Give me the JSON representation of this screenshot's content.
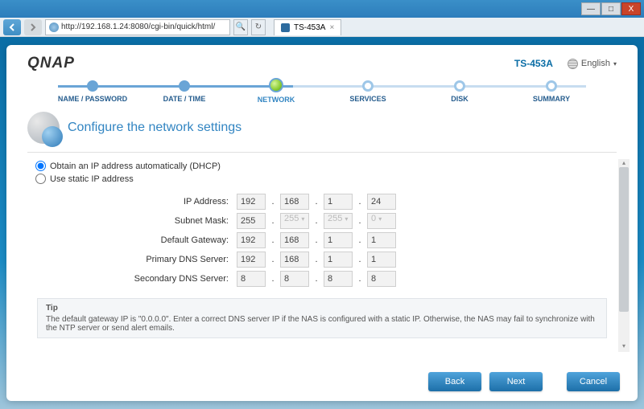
{
  "titlebar": {
    "min": "—",
    "max": "□",
    "close": "X"
  },
  "browser": {
    "url": "http://192.168.1.24:8080/cgi-bin/quick/html/",
    "tab_title": "TS-453A",
    "tab_close": "×",
    "refresh": "↻",
    "search": "🔍"
  },
  "header": {
    "logo": "QNAP",
    "model": "TS-453A",
    "language_label": "English",
    "language_arrow": "▾"
  },
  "steps": [
    {
      "label": "NAME / PASSWORD",
      "state": "done"
    },
    {
      "label": "DATE / TIME",
      "state": "done"
    },
    {
      "label": "NETWORK",
      "state": "current"
    },
    {
      "label": "SERVICES",
      "state": "future"
    },
    {
      "label": "DISK",
      "state": "future"
    },
    {
      "label": "SUMMARY",
      "state": "future"
    }
  ],
  "page": {
    "title": "Configure the network settings",
    "radio_dhcp": "Obtain an IP address automatically (DHCP)",
    "radio_static": "Use static IP address",
    "labels": {
      "ip": "IP Address:",
      "mask": "Subnet Mask:",
      "gw": "Default Gateway:",
      "dns1": "Primary DNS Server:",
      "dns2": "Secondary DNS Server:"
    },
    "values": {
      "ip": [
        "192",
        "168",
        "1",
        "24"
      ],
      "mask": [
        "255",
        "255",
        "255",
        "0"
      ],
      "gw": [
        "192",
        "168",
        "1",
        "1"
      ],
      "dns1": [
        "192",
        "168",
        "1",
        "1"
      ],
      "dns2": [
        "8",
        "8",
        "8",
        "8"
      ]
    },
    "tip_title": "Tip",
    "tip_body": "The default gateway IP is \"0.0.0.0\". Enter a correct DNS server IP if the NAS is configured with a static IP. Otherwise, the NAS may fail to synchronize with the NTP server or send alert emails."
  },
  "buttons": {
    "back": "Back",
    "next": "Next",
    "cancel": "Cancel"
  },
  "scroll": {
    "up": "▴",
    "down": "▾"
  },
  "chevron": "▾"
}
